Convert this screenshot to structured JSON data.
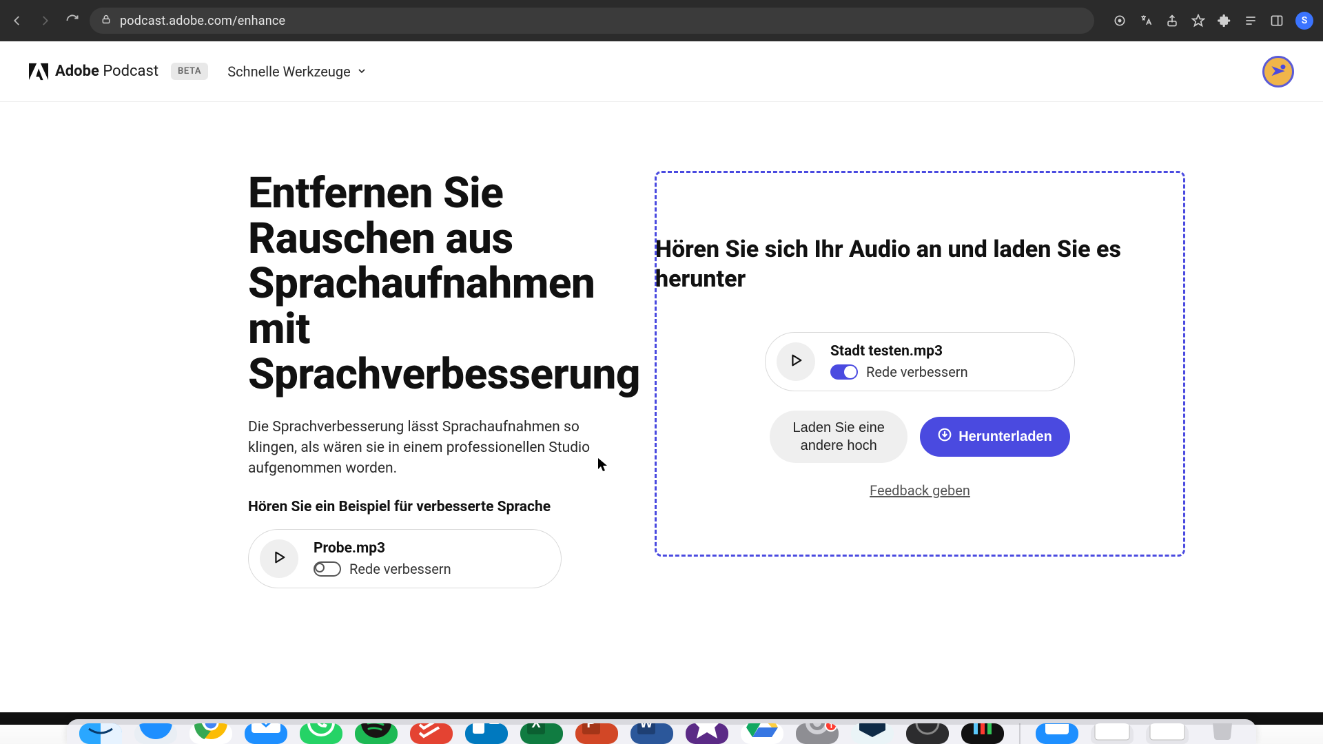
{
  "browser": {
    "url": "podcast.adobe.com/enhance",
    "profile_initial": "S"
  },
  "nav": {
    "brand_first": "Adobe",
    "brand_second": "Podcast",
    "beta": "BETA",
    "menu_label": "Schnelle Werkzeuge"
  },
  "main": {
    "headline": "Entfernen Sie Rauschen aus Sprachaufnahmen mit Sprachverbesserung",
    "subtext": "Die Sprachverbesserung lässt Sprachaufnahmen so klingen, als wären sie in einem professionellen Studio aufgenommen worden.",
    "example_label": "Hören Sie ein Beispiel für verbesserte Sprache",
    "sample": {
      "filename": "Probe.mp3",
      "enhance_label": "Rede verbessern",
      "enhance_on": false
    }
  },
  "dropzone": {
    "title": "Hören Sie sich Ihr Audio an und laden Sie es herunter",
    "file": {
      "filename": "Stadt testen.mp3",
      "enhance_label": "Rede verbessern",
      "enhance_on": true
    },
    "upload_another": "Laden Sie eine andere hoch",
    "download": "Herunterladen",
    "feedback": "Feedback geben"
  },
  "dock": {
    "badge_count": "1"
  },
  "colors": {
    "accent": "#4a4ae0",
    "dashed_border": "#4a4ae0",
    "chrome_bg": "#2b2b2b",
    "addr_bg": "#3b3b3b"
  }
}
